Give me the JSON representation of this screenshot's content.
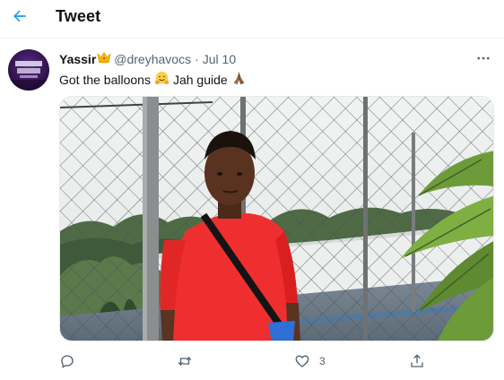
{
  "header": {
    "title": "Tweet",
    "back_icon": "arrow-left-icon",
    "accent_color": "#1d9bf0"
  },
  "tweet": {
    "author": {
      "display_name": "Yassir",
      "badge_emoji": "crown-icon",
      "handle": "@dreyhavocs",
      "separator": "·",
      "date": "Jul 10",
      "avatar_icon": "profile-avatar"
    },
    "text": {
      "part1": "Got the balloons",
      "emoji1": "hugging-face-icon",
      "part2": "Jah guide",
      "emoji2": "folded-hands-icon"
    },
    "media": {
      "type": "photo",
      "description_icon": "photo"
    },
    "actions": {
      "reply_icon": "reply-icon",
      "retweet_icon": "retweet-icon",
      "like_icon": "heart-icon",
      "like_count": "3",
      "share_icon": "share-icon"
    },
    "more_icon": "more-icon"
  }
}
